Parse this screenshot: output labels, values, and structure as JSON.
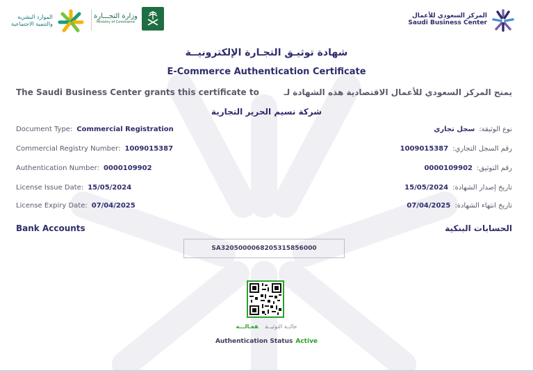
{
  "header": {
    "sbc_logo": {
      "arabic": "المركز السعودي للأعمال",
      "english": "Saudi Business Center"
    },
    "moc_logo": {
      "arabic": "وزارة التجـــارة",
      "english": "Ministry of Commerce"
    },
    "hr_logo": {
      "line1": "الموارد البشرية",
      "line2": "والتنمية الاجتماعية"
    }
  },
  "title": {
    "arabic": "شهادة توثيـق التجـارة الإلكترونيــة",
    "english": "E-Commerce Authentication Certificate"
  },
  "grants": {
    "english": "The Saudi Business Center grants this certificate to",
    "arabic": "يمنح المركز السعودي للأعمال الاقتصادية هذه الشهادة لـ"
  },
  "company_name": "شركة نسيم الحرير التجارية",
  "fields_en": [
    {
      "label": "Document Type:",
      "value": "Commercial Registration"
    },
    {
      "label": "Commercial Registry Number:",
      "value": "1009015387"
    },
    {
      "label": "Authentication Number:",
      "value": "0000109902"
    },
    {
      "label": "License Issue Date:",
      "value": "15/05/2024"
    },
    {
      "label": "License Expiry Date:",
      "value": "07/04/2025"
    }
  ],
  "fields_ar": [
    {
      "label": "نوع الوثيقة:",
      "value": "سجل تجاري"
    },
    {
      "label": "رقم السجل التجاري:",
      "value": "1009015387"
    },
    {
      "label": "رقم التوثيق:",
      "value": "0000109902"
    },
    {
      "label": "تاريخ إصدار الشهادة:",
      "value": "15/05/2024"
    },
    {
      "label": "تاريخ انتهاء الشهادة:",
      "value": "07/04/2025"
    }
  ],
  "bank": {
    "english": "Bank Accounts",
    "arabic": "الحسابات البنكية",
    "iban": "SA3205000068205315856000"
  },
  "status": {
    "arabic_label": "حالــة التوثيــق",
    "arabic_value": "فعـالـــة",
    "english_label": "Authentication Status",
    "english_value": "Active"
  },
  "colors": {
    "primary": "#2f2d6b",
    "active": "#2aa02a",
    "moc_green": "#1f6e43"
  }
}
